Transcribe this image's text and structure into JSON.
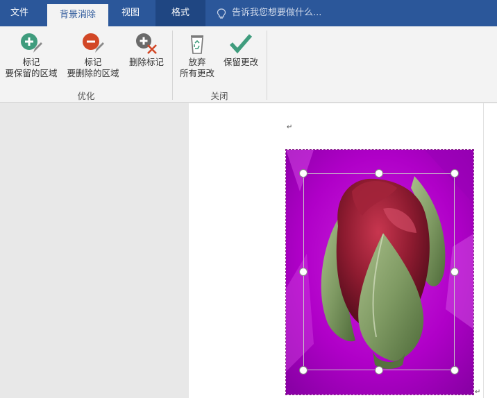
{
  "tabs": {
    "file": "文件",
    "background_removal": "背景消除",
    "view": "视图",
    "format": "格式"
  },
  "tell_me": {
    "placeholder": "告诉我您想要做什么..."
  },
  "ribbon": {
    "mark_keep": {
      "line1": "标记",
      "line2": "要保留的区域"
    },
    "mark_remove": {
      "line1": "标记",
      "line2": "要删除的区域"
    },
    "delete_mark": {
      "label": "删除标记"
    },
    "discard_all": {
      "line1": "放弃",
      "line2": "所有更改"
    },
    "keep_changes": {
      "label": "保留更改"
    },
    "group_refine": "优化",
    "group_close": "关闭"
  },
  "document": {
    "paragraph_mark": "↵"
  },
  "colors": {
    "tab_bar": "#2b579a",
    "keep_icon": "#3f9c7d",
    "remove_icon": "#d24726",
    "removal_overlay": "#b000c8"
  }
}
